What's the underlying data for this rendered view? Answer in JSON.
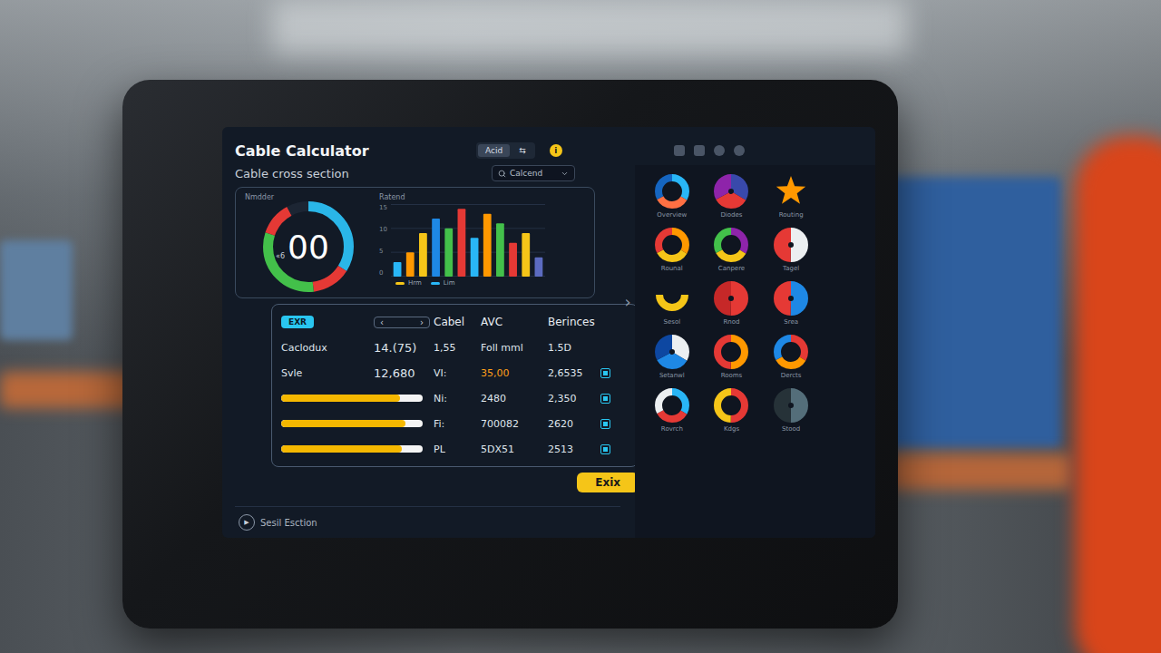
{
  "app": {
    "title": "Cable Calculator",
    "pills": [
      {
        "label": "Acid",
        "selected": true
      },
      {
        "label": "⇆",
        "selected": false
      }
    ],
    "badge": "i"
  },
  "section": {
    "title": "Cable cross section"
  },
  "search": {
    "placeholder": "Calcend"
  },
  "gauge": {
    "label": "Nmdder",
    "value": "00",
    "prefix": "«6",
    "segments": [
      {
        "value": 34,
        "color": "#2ab6e8"
      },
      {
        "value": 14,
        "color": "#e53935"
      },
      {
        "value": 32,
        "color": "#43c04a"
      },
      {
        "value": 12,
        "color": "#e53935"
      },
      {
        "value": 8,
        "color": "#1c2533"
      }
    ]
  },
  "bar_chart": {
    "title": "Ratend",
    "ticks": [
      "15",
      "10",
      "5",
      "0"
    ],
    "values": [
      3,
      5,
      9,
      12,
      10,
      14,
      8,
      13,
      11,
      7,
      9,
      4
    ],
    "colors": [
      "#29b6f6",
      "#ff9800",
      "#f5c518",
      "#1e88e5",
      "#43c04a",
      "#e53935",
      "#29b6f6",
      "#ff9800",
      "#43c04a",
      "#e53935",
      "#f5c518",
      "#5c6bc0"
    ],
    "legend": [
      {
        "label": "Hrm",
        "color": "#f5c518"
      },
      {
        "label": "Lim",
        "color": "#29b6f6"
      }
    ]
  },
  "nav": {
    "next": "›"
  },
  "table": {
    "tab": "EXR",
    "stepper": [
      "‹",
      "›"
    ],
    "columns": [
      "Cabel",
      "AVC",
      "Berinces"
    ],
    "rows": [
      {
        "kind": "text",
        "label": "Caclodux",
        "value": "14.(75)",
        "cells": [
          "1,55",
          "Foll mml",
          "1.5D"
        ],
        "accent": false
      },
      {
        "kind": "text",
        "label": "Svle",
        "value": "12,680",
        "cells": [
          "VI:",
          "35,00",
          "2,6535"
        ],
        "accent": true,
        "checked": true
      },
      {
        "kind": "bar",
        "level": 0.84,
        "cells": [
          "Ni:",
          "2480",
          "2,350"
        ],
        "accent": false,
        "checked": true
      },
      {
        "kind": "bar",
        "level": 0.88,
        "cells": [
          "Fi:",
          "700082",
          "2620"
        ],
        "accent": false,
        "checked": true
      },
      {
        "kind": "bar",
        "level": 0.85,
        "cells": [
          "PL",
          "5DX51",
          "2513"
        ],
        "accent": false,
        "checked": true
      }
    ]
  },
  "primary_button": "Exix",
  "footer": {
    "icon": "▶",
    "label": "Sesil Esction"
  },
  "gallery": [
    {
      "label": "Overview",
      "kind": "donut",
      "colors": [
        "#29b6f6",
        "#ff7043",
        "#1565c0"
      ]
    },
    {
      "label": "Diodes",
      "kind": "pie",
      "colors": [
        "#3949ab",
        "#e53935",
        "#8e24aa"
      ]
    },
    {
      "label": "Routing",
      "kind": "burst",
      "colors": [
        "#ff9800"
      ]
    },
    {
      "label": "Rounal",
      "kind": "donut",
      "colors": [
        "#ff9800",
        "#f5c518",
        "#e53935"
      ]
    },
    {
      "label": "Canpere",
      "kind": "donut",
      "colors": [
        "#8e24aa",
        "#f5c518",
        "#43c04a"
      ]
    },
    {
      "label": "Tagel",
      "kind": "pie",
      "colors": [
        "#eceff1",
        "#e53935"
      ]
    },
    {
      "label": "Sesol",
      "kind": "arc",
      "colors": [
        "#f5c518"
      ]
    },
    {
      "label": "Rnod",
      "kind": "pie",
      "colors": [
        "#e53935",
        "#c62828"
      ]
    },
    {
      "label": "Srea",
      "kind": "pie",
      "colors": [
        "#1e88e5",
        "#e53935"
      ]
    },
    {
      "label": "Setanwl",
      "kind": "pie",
      "colors": [
        "#eceff1",
        "#1e88e5",
        "#0d47a1"
      ]
    },
    {
      "label": "Rooms",
      "kind": "donut",
      "colors": [
        "#ff9800",
        "#e53935"
      ]
    },
    {
      "label": "Dercts",
      "kind": "donut",
      "colors": [
        "#e53935",
        "#ff9800",
        "#1e88e5"
      ]
    },
    {
      "label": "Rovrch",
      "kind": "donut",
      "colors": [
        "#29b6f6",
        "#e53935",
        "#eceff1"
      ]
    },
    {
      "label": "Kdgs",
      "kind": "donut",
      "colors": [
        "#e53935",
        "#f5c518"
      ]
    },
    {
      "label": "Stood",
      "kind": "pie",
      "colors": [
        "#546e7a",
        "#263238"
      ]
    }
  ]
}
